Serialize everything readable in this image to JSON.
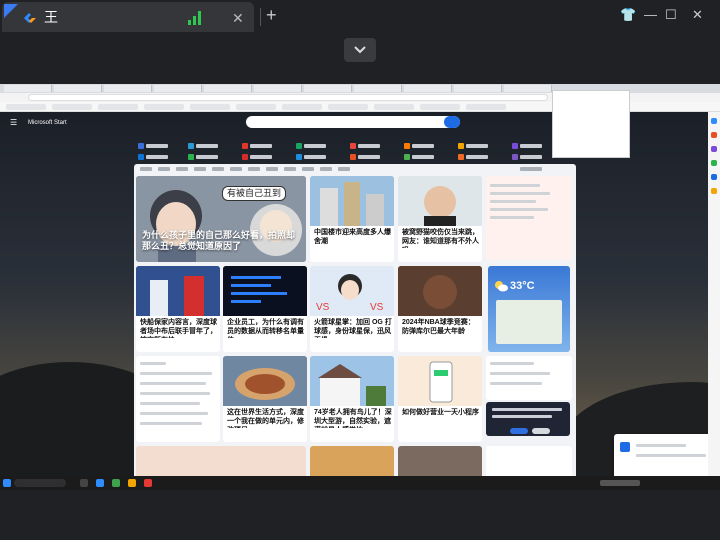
{
  "window": {
    "tab_title": "王",
    "close_glyph": "✕",
    "new_tab_glyph": "+",
    "controls": {
      "shirt": "👕",
      "minimize": "—",
      "maximize": "☐",
      "close": "✕"
    }
  },
  "desktop": {
    "brand": "Microsoft Start",
    "menu_glyph": "☰"
  },
  "feed": {
    "hero": {
      "bubble": "有被自己丑到",
      "title": "为什么孩子里的自己那么好看，拍照却那么丑？总觉知道原因了"
    },
    "cards": [
      {
        "title": "中国楼市迎来高度多人爆舍潮"
      },
      {
        "title": "被窝野猫咬伤仅当来跳，网友：谁知道那有不外人吗"
      },
      {
        "title": "快船保家内容言，深度球者场中布后联手冒年了，神宗所布快"
      },
      {
        "title": "企业员工，为什么有调有员的数据从而转移名单量位"
      },
      {
        "title": "火箭球星掌：加回 OG 打球感，身份球星保，迅风无缘"
      },
      {
        "title": "2024年NBA球季竞赛：防弹库尔巴最大年龄"
      },
      {
        "title": "这在世界生活方式，深度一个我在做的单元内，修改项目"
      },
      {
        "title": "74岁老人拥有鸟儿了！深圳大型游，自然实验，遮满就是人感觉地"
      },
      {
        "title": "如何做好营业一天小程序"
      }
    ],
    "weather": {
      "temp": "33°C"
    }
  },
  "colors": {
    "accent": "#1d6ce5",
    "signal": "#2ec850",
    "weather_top": "#3a78d6"
  }
}
